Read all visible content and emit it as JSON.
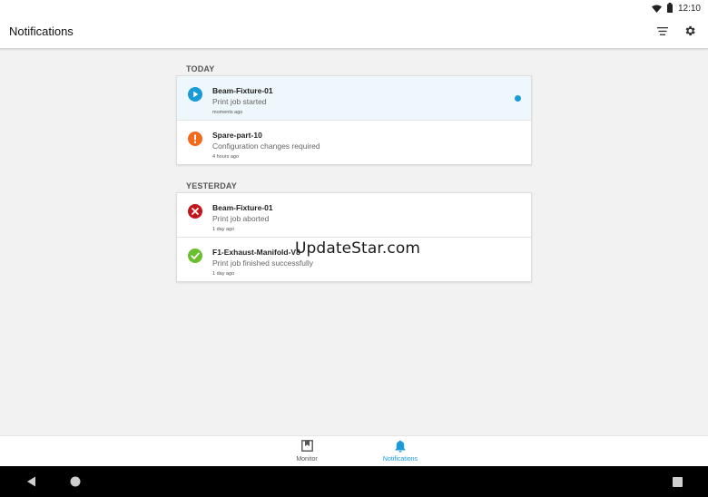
{
  "status_bar": {
    "time": "12:10",
    "icons": [
      "wifi-icon",
      "battery-icon"
    ]
  },
  "app_bar": {
    "title": "Notifications",
    "actions": [
      "filter-icon",
      "settings-gear-icon"
    ]
  },
  "sections": [
    {
      "header": "TODAY",
      "items": [
        {
          "name": "Beam-Fixture-01",
          "message": "Print job started",
          "time": "moments ago",
          "status": "started",
          "icon": "play-icon",
          "unread": true
        },
        {
          "name": "Spare-part-10",
          "message": "Configuration changes required",
          "time": "4 hours ago",
          "status": "warning",
          "icon": "exclamation-icon",
          "unread": false
        }
      ]
    },
    {
      "header": "YESTERDAY",
      "items": [
        {
          "name": "Beam-Fixture-01",
          "message": "Print job aborted",
          "time": "1 day ago",
          "status": "aborted",
          "icon": "error-x-icon",
          "unread": false
        },
        {
          "name": "F1-Exhaust-Manifold-V8",
          "message": "Print job finished successfully",
          "time": "1 day ago",
          "status": "success",
          "icon": "check-icon",
          "unread": false
        }
      ]
    }
  ],
  "watermark": "UpdateStar.com",
  "bottom_nav": {
    "items": [
      {
        "label": "Monitor",
        "icon": "monitor-icon",
        "active": false
      },
      {
        "label": "Notifications",
        "icon": "bell-icon",
        "active": true
      }
    ]
  },
  "system_nav": [
    "back-icon",
    "home-icon",
    "recents-icon"
  ],
  "colors": {
    "accent": "#1a9bd7",
    "warning": "#f26b1d",
    "error": "#c3161c",
    "success": "#6abf2e",
    "background": "#f2f2f2"
  }
}
